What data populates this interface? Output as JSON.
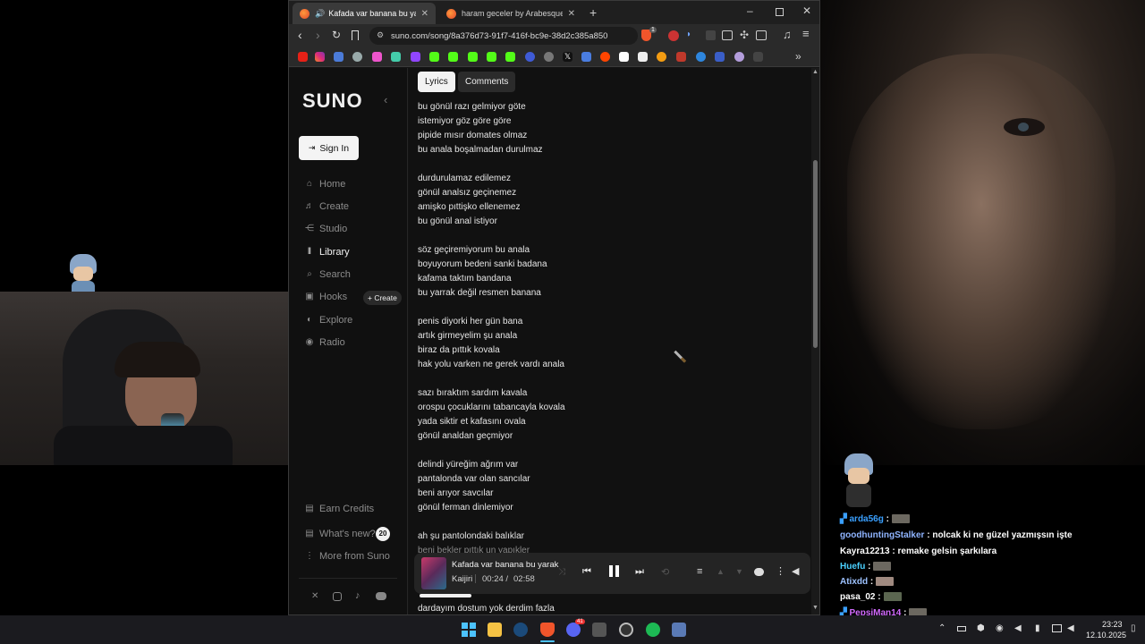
{
  "browser": {
    "tabs": [
      {
        "label": "Kafada var banana bu yarak d",
        "active": true
      },
      {
        "label": "haram geceler by ArabesqueClassica",
        "active": false
      }
    ],
    "url": "suno.com/song/8a376d73-91f7-416f-bc9e-38d2c385a850",
    "shield_badge": "1"
  },
  "suno": {
    "logo": "SUNO",
    "sign_in": "Sign In",
    "nav": [
      {
        "label": "Home",
        "icon": "home-icon"
      },
      {
        "label": "Create",
        "icon": "music-note-icon"
      },
      {
        "label": "Studio",
        "icon": "studio-icon"
      },
      {
        "label": "Library",
        "icon": "library-icon",
        "active": true
      },
      {
        "label": "Search",
        "icon": "search-icon"
      },
      {
        "label": "Hooks",
        "icon": "hooks-icon"
      },
      {
        "label": "Explore",
        "icon": "explore-icon"
      },
      {
        "label": "Radio",
        "icon": "radio-icon"
      }
    ],
    "hooks_create": "+ Create",
    "earn_credits": "Earn Credits",
    "whats_new": "What's new?",
    "whats_new_count": "20",
    "more_from_suno": "More from Suno",
    "tabs": {
      "lyrics": "Lyrics",
      "comments": "Comments"
    }
  },
  "lyrics": [
    "bu gönül razı gelmiyor göte",
    "istemiyor göz göre göre",
    "pipide mısır domates olmaz",
    "bu anala boşalmadan durulmaz",
    "",
    "durdurulamaz edilemez",
    "gönül analsız geçinemez",
    "amişko pıttişko ellenemez",
    "bu gönül anal istiyor",
    "",
    "söz geçiremiyorum bu anala",
    "boyuyorum bedeni sanki badana",
    "kafama taktım bandana",
    "bu yarrak değil resmen banana",
    "",
    "penis diyorki her gün bana",
    "artık girmeyelim şu anala",
    "biraz da pıttık kovala",
    "hak yolu varken ne gerek vardı anala",
    "",
    "sazı bıraktım sardım kavala",
    "orospu çocuklarını tabancayla kovala",
    "yada siktir et kafasını ovala",
    "gönül analdan geçmiyor",
    "",
    "delindi yüreğim ağrım var",
    "pantalonda var olan sancılar",
    "beni arıyor savcılar",
    "gönül ferman dinlemiyor",
    "",
    "ah şu pantolondaki balıklar",
    "beni bekler pıttık un yapıkler"
  ],
  "lyrics_bottom": "dardayım dostum yok derdim fazla",
  "player": {
    "title": "Kafada var banana bu yarak",
    "artist": "Kaijiri",
    "current_time": "00:24 /",
    "duration": "02:58",
    "progress": 0.135
  },
  "chat": [
    {
      "user": "arda56g",
      "text": "",
      "color": "#3aa0ff",
      "emote": true
    },
    {
      "user": "goodhuntingStalker",
      "text": "nolcak ki ne güzel yazmışsın işte",
      "color": "#8fb4ff"
    },
    {
      "user": "Kayra12213",
      "text": "remake gelsin şarkılara",
      "color": "#ffffff"
    },
    {
      "user": "Huefu",
      "text": "",
      "color": "#4ad0ff",
      "emote": true
    },
    {
      "user": "Atixdd",
      "text": "",
      "color": "#9dc2ff",
      "emote": true
    },
    {
      "user": "pasa_02",
      "text": "",
      "color": "#ffffff",
      "emote": true
    },
    {
      "user": "PepsiMan14",
      "text": "",
      "color": "#d36bff",
      "emote": true
    }
  ],
  "taskbar": {
    "time": "23:23",
    "date": "12.10.2025",
    "discord_badge": "41"
  }
}
